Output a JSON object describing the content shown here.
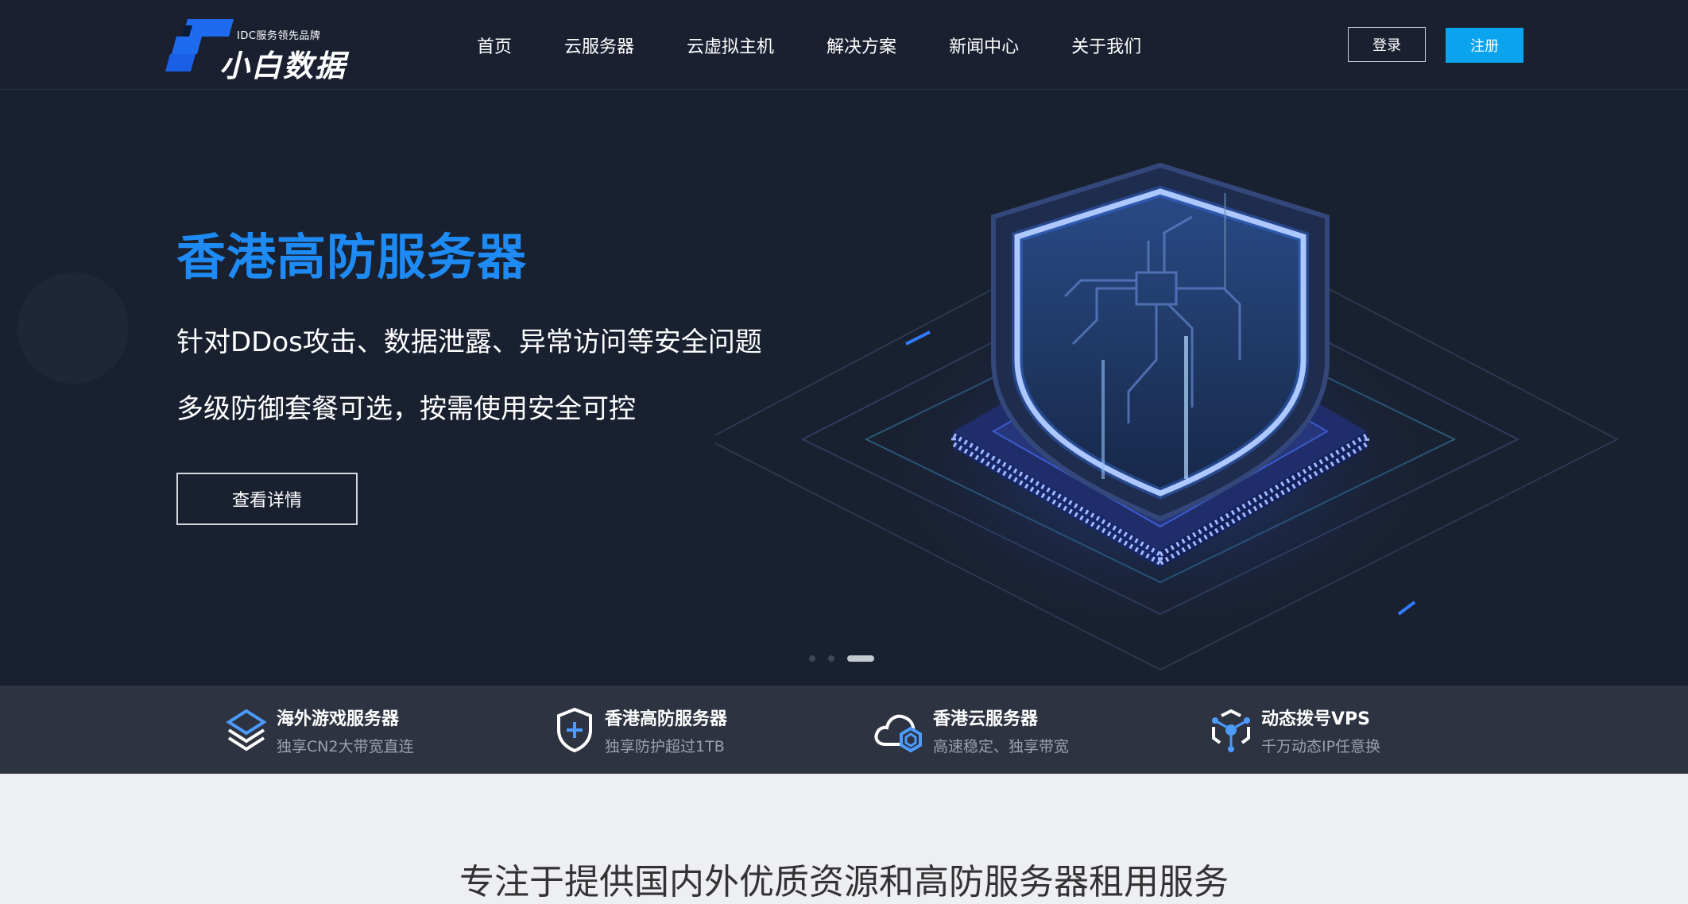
{
  "brand": {
    "tagline": "IDC服务领先品牌",
    "name": "小白数据"
  },
  "nav": {
    "items": [
      "首页",
      "云服务器",
      "云虚拟主机",
      "解决方案",
      "新闻中心",
      "关于我们"
    ],
    "login_label": "登录",
    "register_label": "注册"
  },
  "hero": {
    "title": "香港高防服务器",
    "line1": "针对DDos攻击、数据泄露、异常访问等安全问题",
    "line2": "多级防御套餐可选，按需使用安全可控",
    "button_label": "查看详情",
    "slides_count": 3,
    "active_slide": 3
  },
  "features": [
    {
      "icon": "layers-icon",
      "title": "海外游戏服务器",
      "subtitle": "独享CN2大带宽直连"
    },
    {
      "icon": "shield-plus-icon",
      "title": "香港高防服务器",
      "subtitle": "独享防护超过1TB"
    },
    {
      "icon": "cloud-icon",
      "title": "香港云服务器",
      "subtitle": "高速稳定、独享带宽"
    },
    {
      "icon": "network-icon",
      "title": "动态拨号VPS",
      "subtitle": "千万动态IP任意换"
    }
  ],
  "intro": {
    "title": "专注于提供国内外优质资源和高防服务器租用服务"
  },
  "colors": {
    "nav_bg": "#1a2030",
    "hero_bg": "#192030",
    "accent_blue": "#1e8bf5",
    "register_bg": "#0aa3ee",
    "feature_bg": "#2d3340",
    "page_bg": "#eeeff3"
  }
}
